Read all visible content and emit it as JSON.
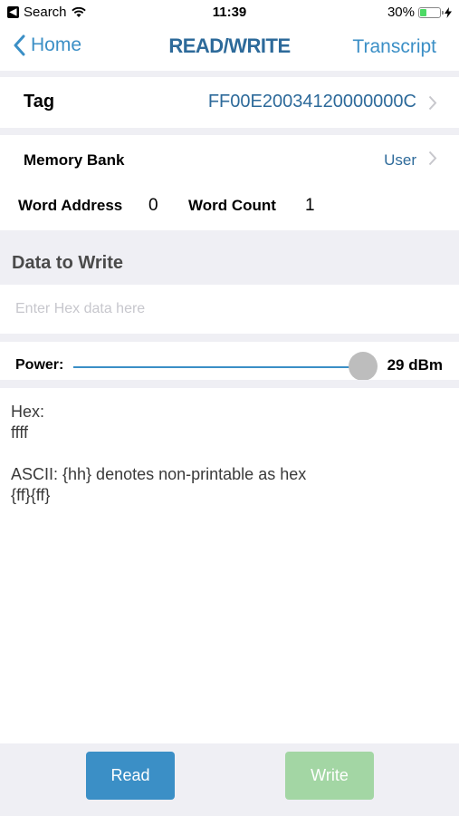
{
  "status_bar": {
    "back_app": "Search",
    "time": "11:39",
    "battery_percent": "30%",
    "battery_level": 0.3
  },
  "nav": {
    "back_label": "Home",
    "title": "READ/WRITE",
    "right_label": "Transcript"
  },
  "tag": {
    "label": "Tag",
    "value": "FF00E20034120000000C"
  },
  "memory_bank": {
    "label": "Memory Bank",
    "value": "User"
  },
  "word_address": {
    "label": "Word Address",
    "value": "0"
  },
  "word_count": {
    "label": "Word Count",
    "value": "1"
  },
  "data_to_write": {
    "heading": "Data to Write",
    "placeholder": "Enter Hex data here",
    "value": ""
  },
  "power": {
    "label": "Power:",
    "value": "29 dBm",
    "slider_fraction": 0.95
  },
  "output": {
    "hex_label": "Hex:",
    "hex_value": "ffff",
    "ascii_label": "ASCII: {hh} denotes non-printable as hex",
    "ascii_value": "{ff}{ff}"
  },
  "actions": {
    "read_label": "Read",
    "write_label": "Write"
  },
  "colors": {
    "accent": "#3b8fc6",
    "title": "#2d6a9a",
    "write_disabled": "#a3d6a4",
    "group_background": "#efeff4"
  }
}
